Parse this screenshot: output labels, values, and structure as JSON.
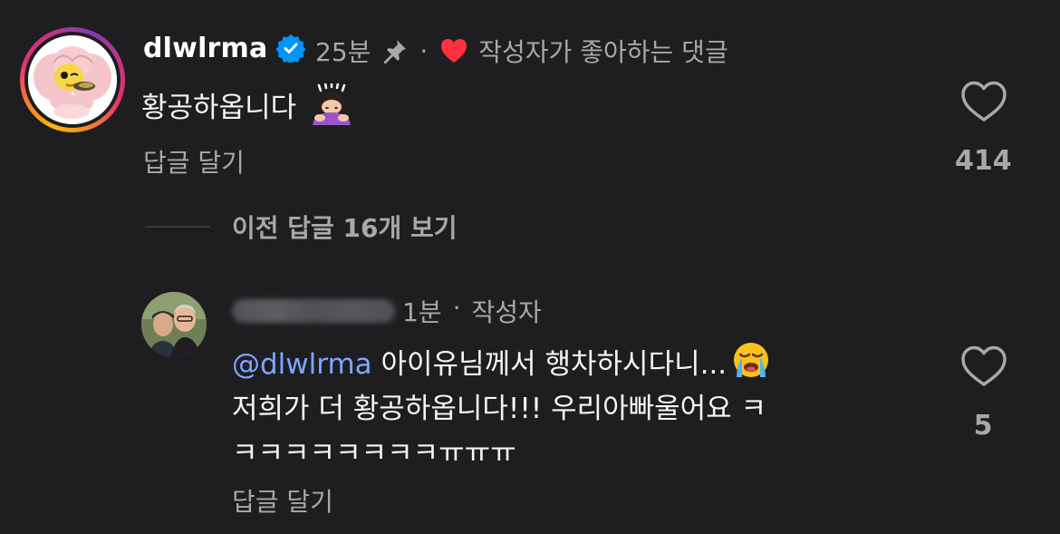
{
  "main_comment": {
    "username": "dlwlrma",
    "time": "25분",
    "separator": "·",
    "creator_liked": "작성자가 좋아하는 댓글",
    "text": "황공하옵니다",
    "emoji": "bowing-woman-emoji",
    "reply_label": "답글 달기",
    "like_count": "414"
  },
  "view_previous": "이전 답글 16개 보기",
  "reply": {
    "username_blurred": "kassiripan",
    "time": "1분",
    "separator": "·",
    "author_badge": "작성자",
    "mention": "@dlwlrma",
    "text_1": " 아이유님께서 행차하시다니...",
    "text_2": "저희가 더 황공하옵니다!!! 우리아빠울어요 ㅋ",
    "text_3": "ㅋㅋㅋㅋㅋㅋㅋㅋㅠㅠㅠ",
    "emoji": "loudly-crying-emoji",
    "reply_label": "답글 달기",
    "like_count": "5"
  },
  "colors": {
    "background": "#1e1e21",
    "secondary_text": "#a8a8a8",
    "mention": "#7ea6ff",
    "verified": "#0095f6",
    "heart": "#ff3040"
  },
  "icons": [
    "verified-badge-icon",
    "pin-icon",
    "heart-filled-icon",
    "heart-outline-icon"
  ]
}
